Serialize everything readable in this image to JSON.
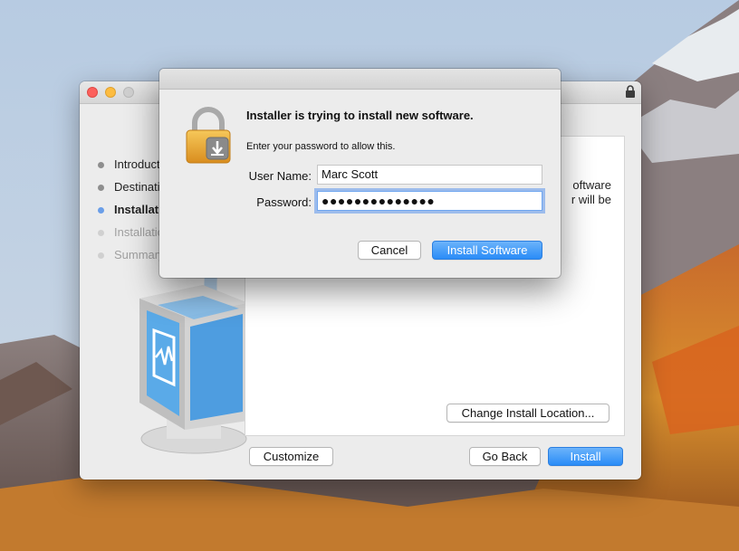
{
  "installer": {
    "steps": [
      {
        "label": "Introduction",
        "state": "done"
      },
      {
        "label": "Destination Select",
        "state": "done"
      },
      {
        "label": "Installation Type",
        "state": "active"
      },
      {
        "label": "Installation",
        "state": "future"
      },
      {
        "label": "Summary",
        "state": "future"
      }
    ],
    "content_line1": "oftware",
    "content_line2": "r will be",
    "change_location_label": "Change Install Location...",
    "customize_label": "Customize",
    "go_back_label": "Go Back",
    "install_label": "Install"
  },
  "dialog": {
    "title": "Installer is trying to install new software.",
    "subtitle": "Enter your password to allow this.",
    "username_label": "User Name:",
    "username_value": "Marc Scott",
    "password_label": "Password:",
    "password_value": "●●●●●●●●●●●●●●",
    "cancel_label": "Cancel",
    "install_software_label": "Install Software"
  },
  "colors": {
    "accent": "#2a8cf7",
    "active_step_dot": "#6a9ee8",
    "padlock": "#e9a93a"
  }
}
